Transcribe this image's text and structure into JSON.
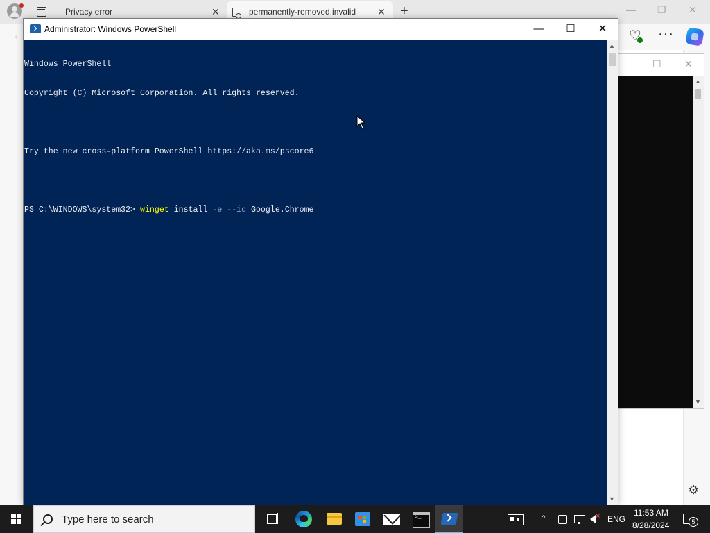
{
  "browser": {
    "tabs": [
      {
        "title": "Privacy error",
        "close": "✕"
      },
      {
        "title": "permanently-removed.invalid",
        "close": "✕"
      }
    ],
    "new_tab": "+",
    "window_buttons": [
      "—",
      "❐",
      "✕"
    ],
    "back": "←"
  },
  "console_behind": {
    "buttons": [
      "—",
      "☐",
      "✕"
    ],
    "scroll_up": "▲",
    "scroll_down": "▼"
  },
  "powershell": {
    "title": "Administrator: Windows PowerShell",
    "window_buttons": {
      "minimize": "—",
      "maximize": "☐",
      "close": "✕"
    },
    "lines": {
      "l1": "Windows PowerShell",
      "l2": "Copyright (C) Microsoft Corporation. All rights reserved.",
      "l3": "Try the new cross-platform PowerShell https://aka.ms/pscore6",
      "prompt": "PS C:\\WINDOWS\\system32> ",
      "cmd": "winget",
      "arg1": " install ",
      "flag1": "-e",
      "space": " ",
      "flag2": "--id",
      "arg2": " Google.Chrome"
    },
    "scroll_up": "▲",
    "scroll_down": "▼",
    "colors": {
      "background": "#012456",
      "text": "#eeedf0",
      "command": "#ffff00",
      "parameter": "#8ba0b8"
    }
  },
  "taskbar": {
    "search_placeholder": "Type here to search",
    "tray": {
      "chevron": "⌃",
      "language": "ENG",
      "time": "11:53 AM",
      "date": "8/28/2024",
      "notifications": "5"
    },
    "apps": [
      "task-view",
      "edge",
      "file-explorer",
      "microsoft-store",
      "mail",
      "command-prompt",
      "powershell"
    ]
  },
  "sidebar": {
    "settings": "⚙"
  }
}
